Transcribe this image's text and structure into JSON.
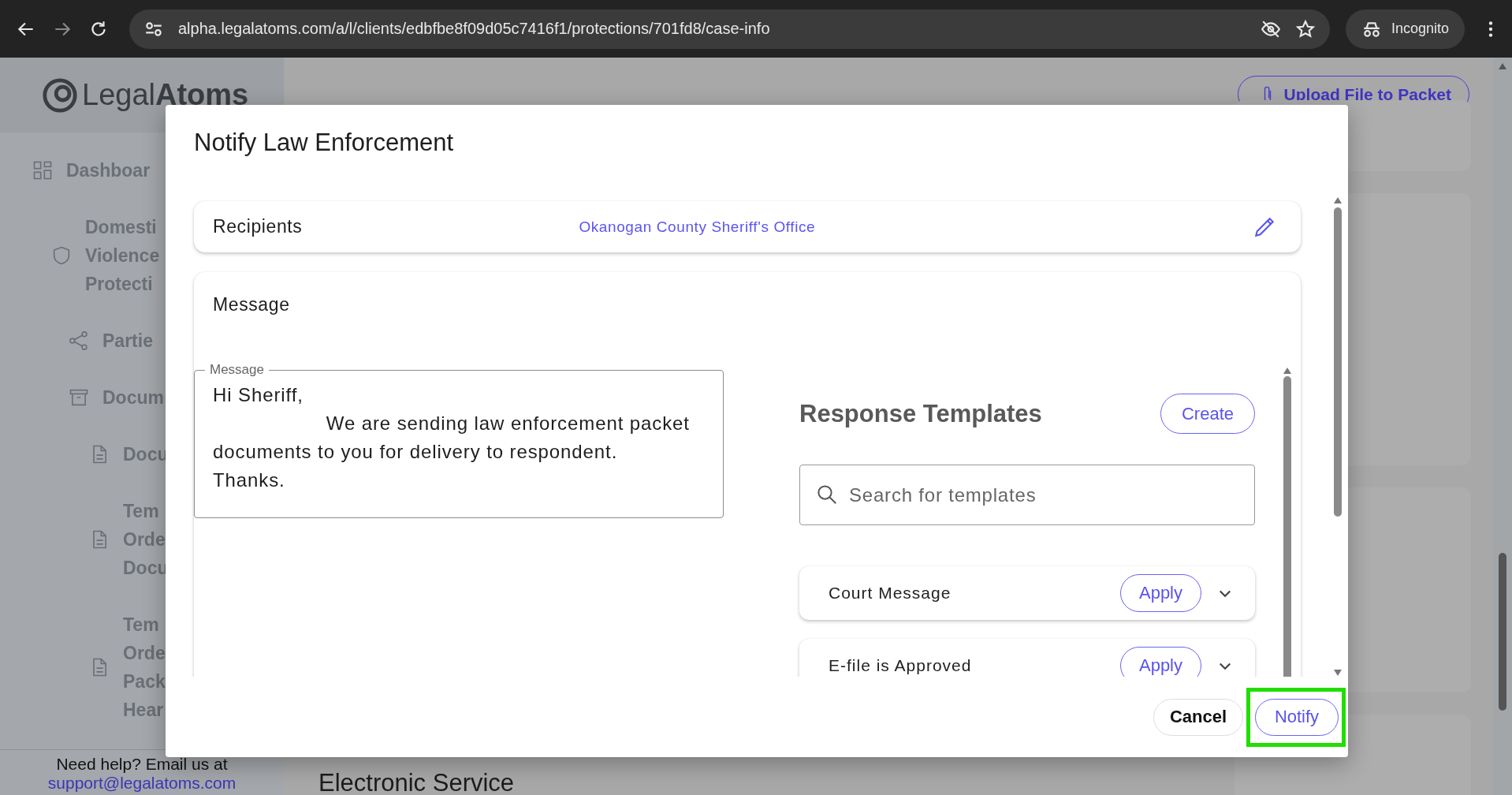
{
  "browser": {
    "url": "alpha.legalatoms.com/a/l/clients/edbfbe8f09d05c7416f1/protections/701fd8/case-info",
    "profile": "Incognito"
  },
  "sidebar": {
    "logo": {
      "light": "Legal",
      "bold": "Atoms"
    },
    "items": [
      {
        "kind": "dashboard",
        "label": "Dashboar"
      },
      {
        "kind": "shield",
        "label": "Domesti\nViolence\nProtecti",
        "children": [
          {
            "kind": "share",
            "label": "Partie"
          },
          {
            "kind": "archive",
            "label": "Docum",
            "children": [
              {
                "kind": "document",
                "label": "Docu"
              },
              {
                "kind": "document",
                "label": "Tem\nOrde\nDocu"
              },
              {
                "kind": "document",
                "label": "Tem\nOrde\nPack\nHear"
              }
            ]
          }
        ]
      }
    ],
    "help": "Need help? Email us at",
    "email": "support@legalatoms.com"
  },
  "page": {
    "upload_button": "Upload File to Packet",
    "section_heading": "Electronic Service"
  },
  "dialog": {
    "title": "Notify Law Enforcement",
    "recipients": {
      "label": "Recipients",
      "value": "Okanogan County Sheriff's Office"
    },
    "message": {
      "heading": "Message",
      "field_label": "Message",
      "value": "Hi Sheriff,\n                   We are sending law enforcement packet documents to you for delivery to respondent.\nThanks."
    },
    "templates": {
      "title": "Response Templates",
      "create_button": "Create",
      "search": {
        "placeholder": "Search for templates"
      },
      "items": [
        {
          "name": "Court Message",
          "apply": "Apply",
          "expanded": false
        },
        {
          "name": "E-file is Approved",
          "apply": "Apply",
          "expanded": false
        }
      ]
    },
    "buttons": [
      {
        "label": "Cancel",
        "kind": "secondary",
        "highlighted": false
      },
      {
        "label": "Notify",
        "kind": "primary",
        "highlighted": true
      }
    ]
  }
}
